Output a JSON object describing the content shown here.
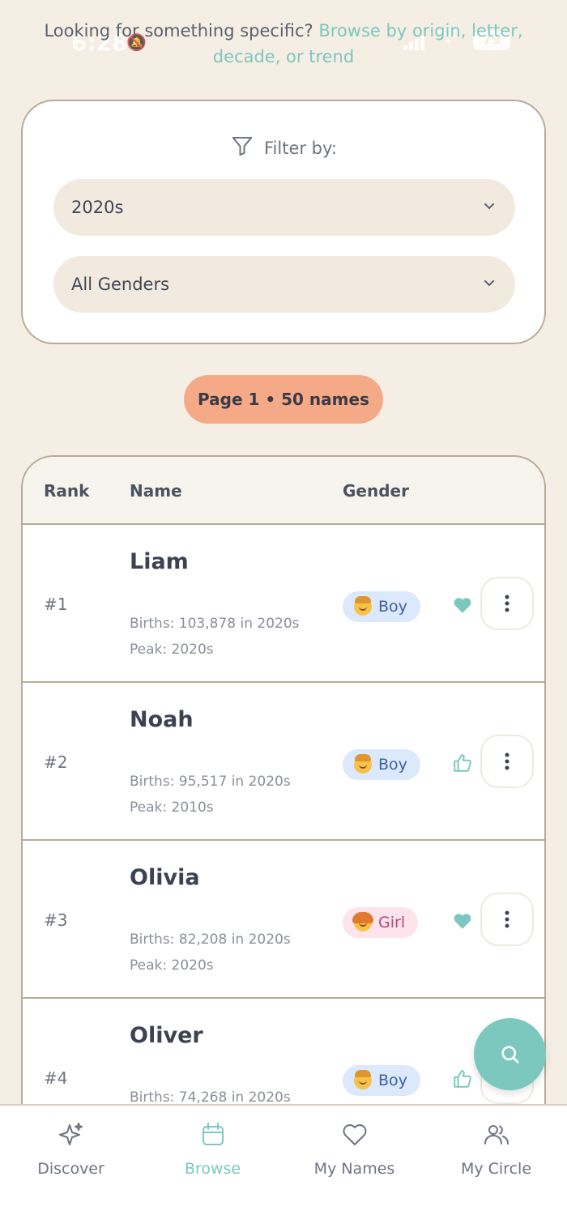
{
  "status_bar": {
    "time": "6:28",
    "battery": "79"
  },
  "intro": {
    "text": "Looking for something specific? ",
    "link": "Browse by origin, letter, decade, or trend"
  },
  "filter": {
    "title": "Filter by:",
    "decade_select": "2020s",
    "gender_select": "All Genders"
  },
  "pagination": {
    "label": "Page 1 • 50 names"
  },
  "table": {
    "headers": {
      "rank": "Rank",
      "name": "Name",
      "gender": "Gender"
    },
    "rows": [
      {
        "rank": "#1",
        "name": "Liam",
        "births": "Births: 103,878 in 2020s",
        "peak": "Peak: 2020s",
        "gender": "Boy",
        "reaction": "heart-filled-icon"
      },
      {
        "rank": "#2",
        "name": "Noah",
        "births": "Births: 95,517 in 2020s",
        "peak": "Peak: 2010s",
        "gender": "Boy",
        "reaction": "thumbs-up-icon"
      },
      {
        "rank": "#3",
        "name": "Olivia",
        "births": "Births: 82,208 in 2020s",
        "peak": "Peak: 2020s",
        "gender": "Girl",
        "reaction": "heart-filled-icon"
      },
      {
        "rank": "#4",
        "name": "Oliver",
        "births": "Births: 74,268 in 2020s",
        "peak": "",
        "gender": "Boy",
        "reaction": "thumbs-up-icon"
      }
    ]
  },
  "nav": {
    "tabs": [
      {
        "label": "Discover",
        "icon": "sparkle-icon"
      },
      {
        "label": "Browse",
        "icon": "calendar-icon",
        "active": true
      },
      {
        "label": "My Names",
        "icon": "heart-icon"
      },
      {
        "label": "My Circle",
        "icon": "people-icon"
      }
    ]
  },
  "colors": {
    "accent": "#7CC8BE",
    "background": "#F5EEE4",
    "pill": "#F4A987"
  }
}
